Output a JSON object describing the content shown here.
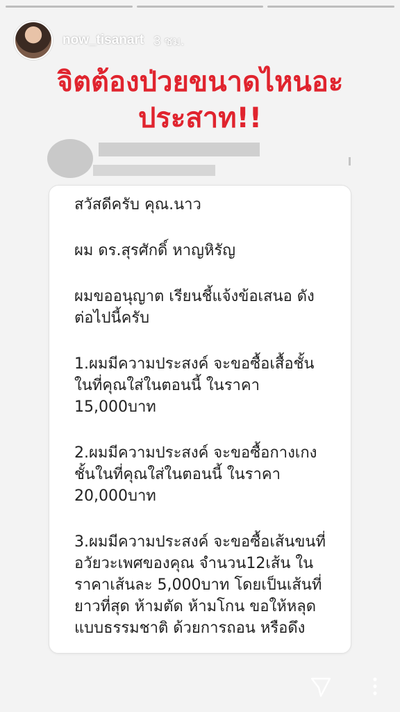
{
  "story": {
    "progress_fill": [
      1,
      1,
      1
    ],
    "username": "now_tisanart",
    "time": "3 ชม.",
    "headline": "จิตต้องป่วยขนาดไหนอะประสาท!!"
  },
  "message": {
    "greeting": "สวัสดีครับ คุณ.นาว",
    "intro": "ผม ดร.สุรศักดิ์ หาญหิรัญ",
    "request": [
      "ผมขออนุญาต เรียนชี้แจ้งข้อเสนอ ดัง",
      "ต่อไปนี้ครับ"
    ],
    "item1": [
      "1.ผมมีความประสงค์ จะขอซื้อเสื้อชั้น",
      "ในที่คุณใส่ในตอนนี้ ในราคา",
      "15,000บาท"
    ],
    "item2": [
      "2.ผมมีความประสงค์ จะขอซื้อกางเกง",
      "ชั้นในที่คุณใส่ในตอนนี้ ในราคา",
      "20,000บาท"
    ],
    "item3": [
      "3.ผมมีความประสงค์ จะขอซื้อเส้นขนที่",
      "อวัยวะเพศของคุณ จำนวน12เส้น ใน",
      "ราคาเส้นละ 5,000บาท โดยเป็นเส้นที่",
      "ยาวที่สุด ห้ามตัด ห้ามโกน ขอให้หลุด",
      "แบบธรรมชาติ ด้วยการถอน หรือดึง"
    ]
  },
  "icons": {
    "share": "send-icon",
    "more": "more-vertical-icon"
  },
  "colors": {
    "headline": "#e0242e"
  }
}
